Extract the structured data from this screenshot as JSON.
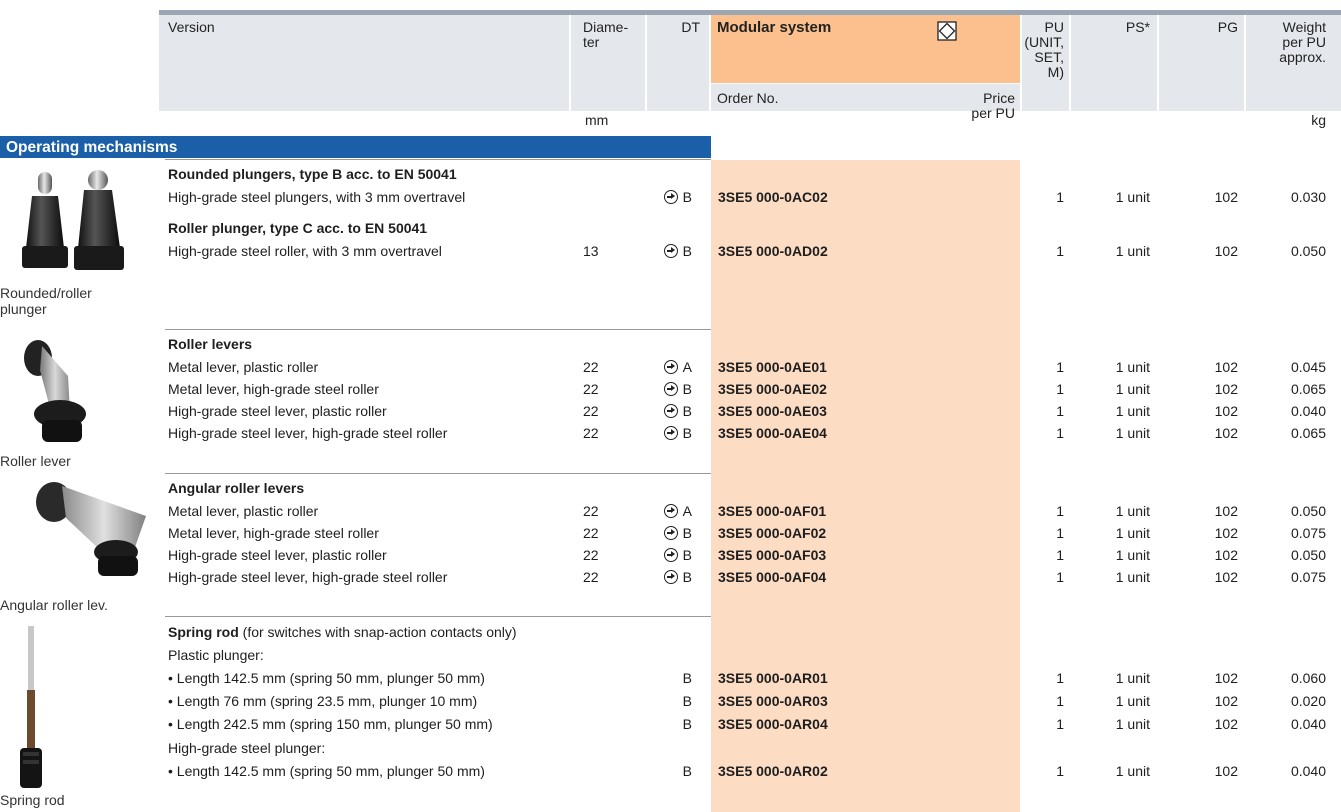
{
  "header": {
    "version": "Version",
    "diameter": "Diame-\nter",
    "dt": "DT",
    "modular_system": "Modular system",
    "pu": "PU\n(UNIT,\nSET,\nM)",
    "ps": "PS*",
    "pg": "PG",
    "weight": "Weight\nper PU\napprox.",
    "order_no": "Order No.",
    "price": "Price\nper PU",
    "unit_mm": "mm",
    "unit_kg": "kg"
  },
  "section_title": "Operating mechanisms",
  "image_labels": {
    "plunger": "Rounded/roller\nplunger",
    "roller_lever": "Roller lever",
    "angular": "Angular roller lev.",
    "spring_rod": "Spring rod"
  },
  "groups": {
    "g1_title": "Rounded plungers, type B acc. to EN 50041",
    "g2_title": "Roller plunger, type C acc. to EN 50041",
    "g3_title": "Roller levers",
    "g4_title": "Angular roller levers",
    "g5_title": "Spring rod",
    "g5_title_suffix": " (for switches with snap-action contacts only)",
    "g5_sub1": "Plastic plunger:",
    "g5_sub2": "High-grade steel plunger:"
  },
  "rows": [
    {
      "desc": "High-grade steel plungers, with 3 mm overtravel",
      "dia": "",
      "dt": "B",
      "order": "3SE5 000-0AC02",
      "pu": "1",
      "ps": "1 unit",
      "pg": "102",
      "w": "0.030"
    },
    {
      "desc": "High-grade steel roller, with 3 mm overtravel",
      "dia": "13",
      "dt": "B",
      "order": "3SE5 000-0AD02",
      "pu": "1",
      "ps": "1 unit",
      "pg": "102",
      "w": "0.050"
    },
    {
      "desc": "Metal lever, plastic roller",
      "dia": "22",
      "dt": "A",
      "order": "3SE5 000-0AE01",
      "pu": "1",
      "ps": "1 unit",
      "pg": "102",
      "w": "0.045"
    },
    {
      "desc": "Metal lever, high-grade steel roller",
      "dia": "22",
      "dt": "B",
      "order": "3SE5 000-0AE02",
      "pu": "1",
      "ps": "1 unit",
      "pg": "102",
      "w": "0.065"
    },
    {
      "desc": "High-grade steel lever, plastic roller",
      "dia": "22",
      "dt": "B",
      "order": "3SE5 000-0AE03",
      "pu": "1",
      "ps": "1 unit",
      "pg": "102",
      "w": "0.040"
    },
    {
      "desc": "High-grade steel lever, high-grade steel roller",
      "dia": "22",
      "dt": "B",
      "order": "3SE5 000-0AE04",
      "pu": "1",
      "ps": "1 unit",
      "pg": "102",
      "w": "0.065"
    },
    {
      "desc": "Metal lever, plastic roller",
      "dia": "22",
      "dt": "A",
      "order": "3SE5 000-0AF01",
      "pu": "1",
      "ps": "1 unit",
      "pg": "102",
      "w": "0.050"
    },
    {
      "desc": "Metal lever, high-grade steel roller",
      "dia": "22",
      "dt": "B",
      "order": "3SE5 000-0AF02",
      "pu": "1",
      "ps": "1 unit",
      "pg": "102",
      "w": "0.075"
    },
    {
      "desc": "High-grade steel lever, plastic roller",
      "dia": "22",
      "dt": "B",
      "order": "3SE5 000-0AF03",
      "pu": "1",
      "ps": "1 unit",
      "pg": "102",
      "w": "0.050"
    },
    {
      "desc": "High-grade steel lever, high-grade steel roller",
      "dia": "22",
      "dt": "B",
      "order": "3SE5 000-0AF04",
      "pu": "1",
      "ps": "1 unit",
      "pg": "102",
      "w": "0.075"
    },
    {
      "desc": "• Length 142.5 mm (spring 50 mm, plunger 50 mm)",
      "dia": "",
      "dt": "B",
      "order": "3SE5 000-0AR01",
      "pu": "1",
      "ps": "1 unit",
      "pg": "102",
      "w": "0.060"
    },
    {
      "desc": "• Length 76 mm (spring 23.5 mm, plunger 10 mm)",
      "dia": "",
      "dt": "B",
      "order": "3SE5 000-0AR03",
      "pu": "1",
      "ps": "1 unit",
      "pg": "102",
      "w": "0.020"
    },
    {
      "desc": "• Length 242.5 mm (spring 150 mm, plunger 50 mm)",
      "dia": "",
      "dt": "B",
      "order": "3SE5 000-0AR04",
      "pu": "1",
      "ps": "1 unit",
      "pg": "102",
      "w": "0.040"
    },
    {
      "desc": "• Length 142.5 mm (spring 50 mm, plunger 50 mm)",
      "dia": "",
      "dt": "B",
      "order": "3SE5 000-0AR02",
      "pu": "1",
      "ps": "1 unit",
      "pg": "102",
      "w": "0.040"
    }
  ]
}
